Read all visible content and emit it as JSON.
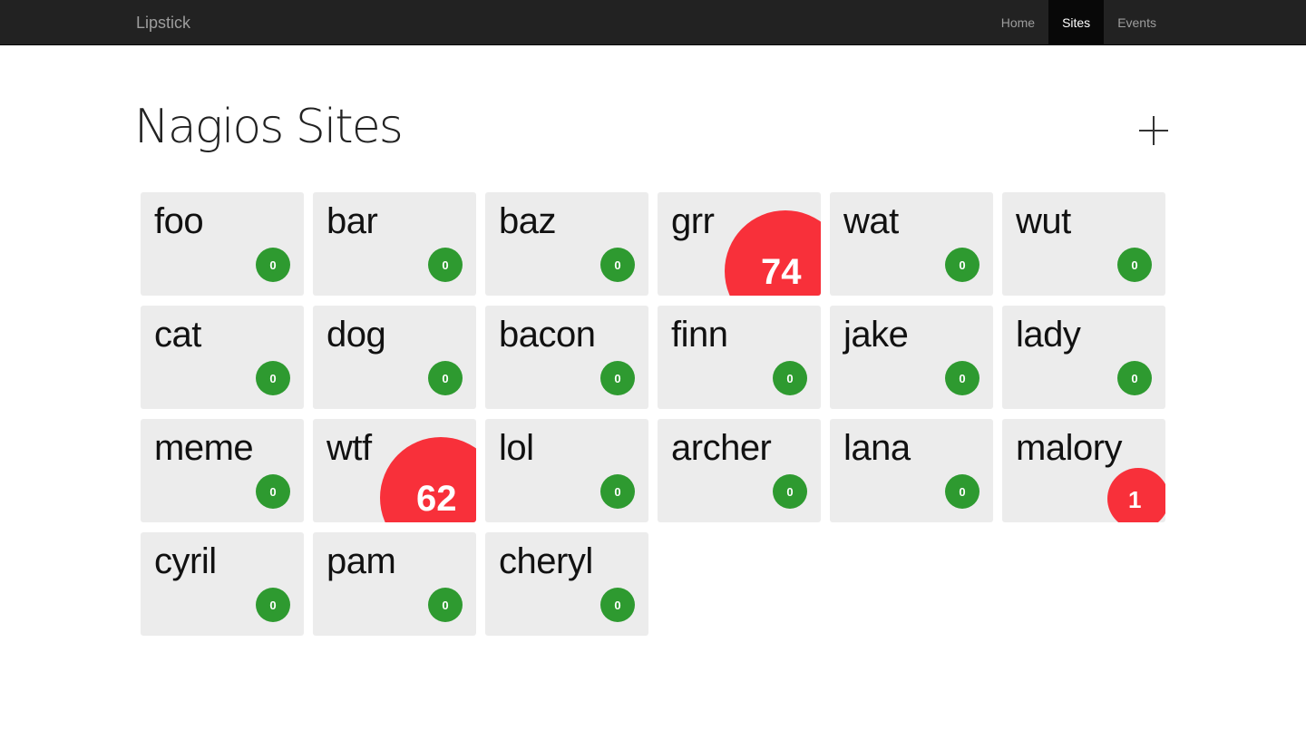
{
  "navbar": {
    "brand": "Lipstick",
    "items": [
      {
        "label": "Home",
        "active": false
      },
      {
        "label": "Sites",
        "active": true
      },
      {
        "label": "Events",
        "active": false
      }
    ]
  },
  "page": {
    "title": "Nagios Sites",
    "add_icon": "plus-icon"
  },
  "colors": {
    "ok": "#2e9a30",
    "problem": "#f8303a",
    "tile": "#ececec",
    "navbar": "#222222"
  },
  "sites": [
    {
      "name": "foo",
      "count": "0",
      "status": "ok"
    },
    {
      "name": "bar",
      "count": "0",
      "status": "ok"
    },
    {
      "name": "baz",
      "count": "0",
      "status": "ok"
    },
    {
      "name": "grr",
      "count": "74",
      "status": "problem"
    },
    {
      "name": "wat",
      "count": "0",
      "status": "ok"
    },
    {
      "name": "wut",
      "count": "0",
      "status": "ok"
    },
    {
      "name": "cat",
      "count": "0",
      "status": "ok"
    },
    {
      "name": "dog",
      "count": "0",
      "status": "ok"
    },
    {
      "name": "bacon",
      "count": "0",
      "status": "ok"
    },
    {
      "name": "finn",
      "count": "0",
      "status": "ok"
    },
    {
      "name": "jake",
      "count": "0",
      "status": "ok"
    },
    {
      "name": "lady",
      "count": "0",
      "status": "ok"
    },
    {
      "name": "meme",
      "count": "0",
      "status": "ok"
    },
    {
      "name": "wtf",
      "count": "62",
      "status": "problem"
    },
    {
      "name": "lol",
      "count": "0",
      "status": "ok"
    },
    {
      "name": "archer",
      "count": "0",
      "status": "ok"
    },
    {
      "name": "lana",
      "count": "0",
      "status": "ok"
    },
    {
      "name": "malory",
      "count": "1",
      "status": "problem"
    },
    {
      "name": "cyril",
      "count": "0",
      "status": "ok"
    },
    {
      "name": "pam",
      "count": "0",
      "status": "ok"
    },
    {
      "name": "cheryl",
      "count": "0",
      "status": "ok"
    }
  ]
}
